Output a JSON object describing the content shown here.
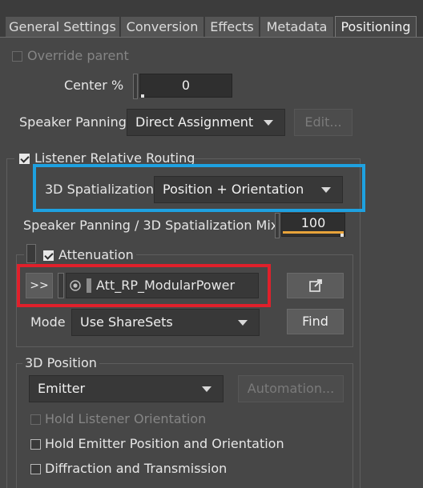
{
  "tabs": [
    {
      "label": "General Settings"
    },
    {
      "label": "Conversion"
    },
    {
      "label": "Effects"
    },
    {
      "label": "Metadata"
    },
    {
      "label": "Positioning"
    }
  ],
  "override_parent": {
    "label": "Override parent",
    "checked": false
  },
  "center": {
    "label": "Center %",
    "value": "0"
  },
  "speaker_panning": {
    "label": "Speaker Panning",
    "value": "Direct Assignment",
    "edit_label": "Edit..."
  },
  "listener_relative_routing": {
    "label": "Listener Relative Routing",
    "checked": true
  },
  "spatialization": {
    "label": "3D Spatialization",
    "value": "Position + Orientation"
  },
  "mix": {
    "label": "Speaker Panning / 3D Spatialization Mix",
    "value": "100"
  },
  "attenuation": {
    "label": "Attenuation",
    "checked": true,
    "expand_label": ">>",
    "shareset_name": "Att_RP_ModularPower",
    "mode_label": "Mode",
    "mode_value": "Use ShareSets",
    "find_label": "Find"
  },
  "position_3d": {
    "label": "3D Position",
    "value": "Emitter",
    "automation_label": "Automation...",
    "hold_listener": "Hold Listener Orientation",
    "hold_emitter": "Hold Emitter Position and Orientation",
    "diffraction": "Diffraction and Transmission"
  },
  "colors": {
    "highlight_blue": "#1ea1e0",
    "highlight_red": "#e0202b",
    "accent_orange": "#e8a33a"
  }
}
